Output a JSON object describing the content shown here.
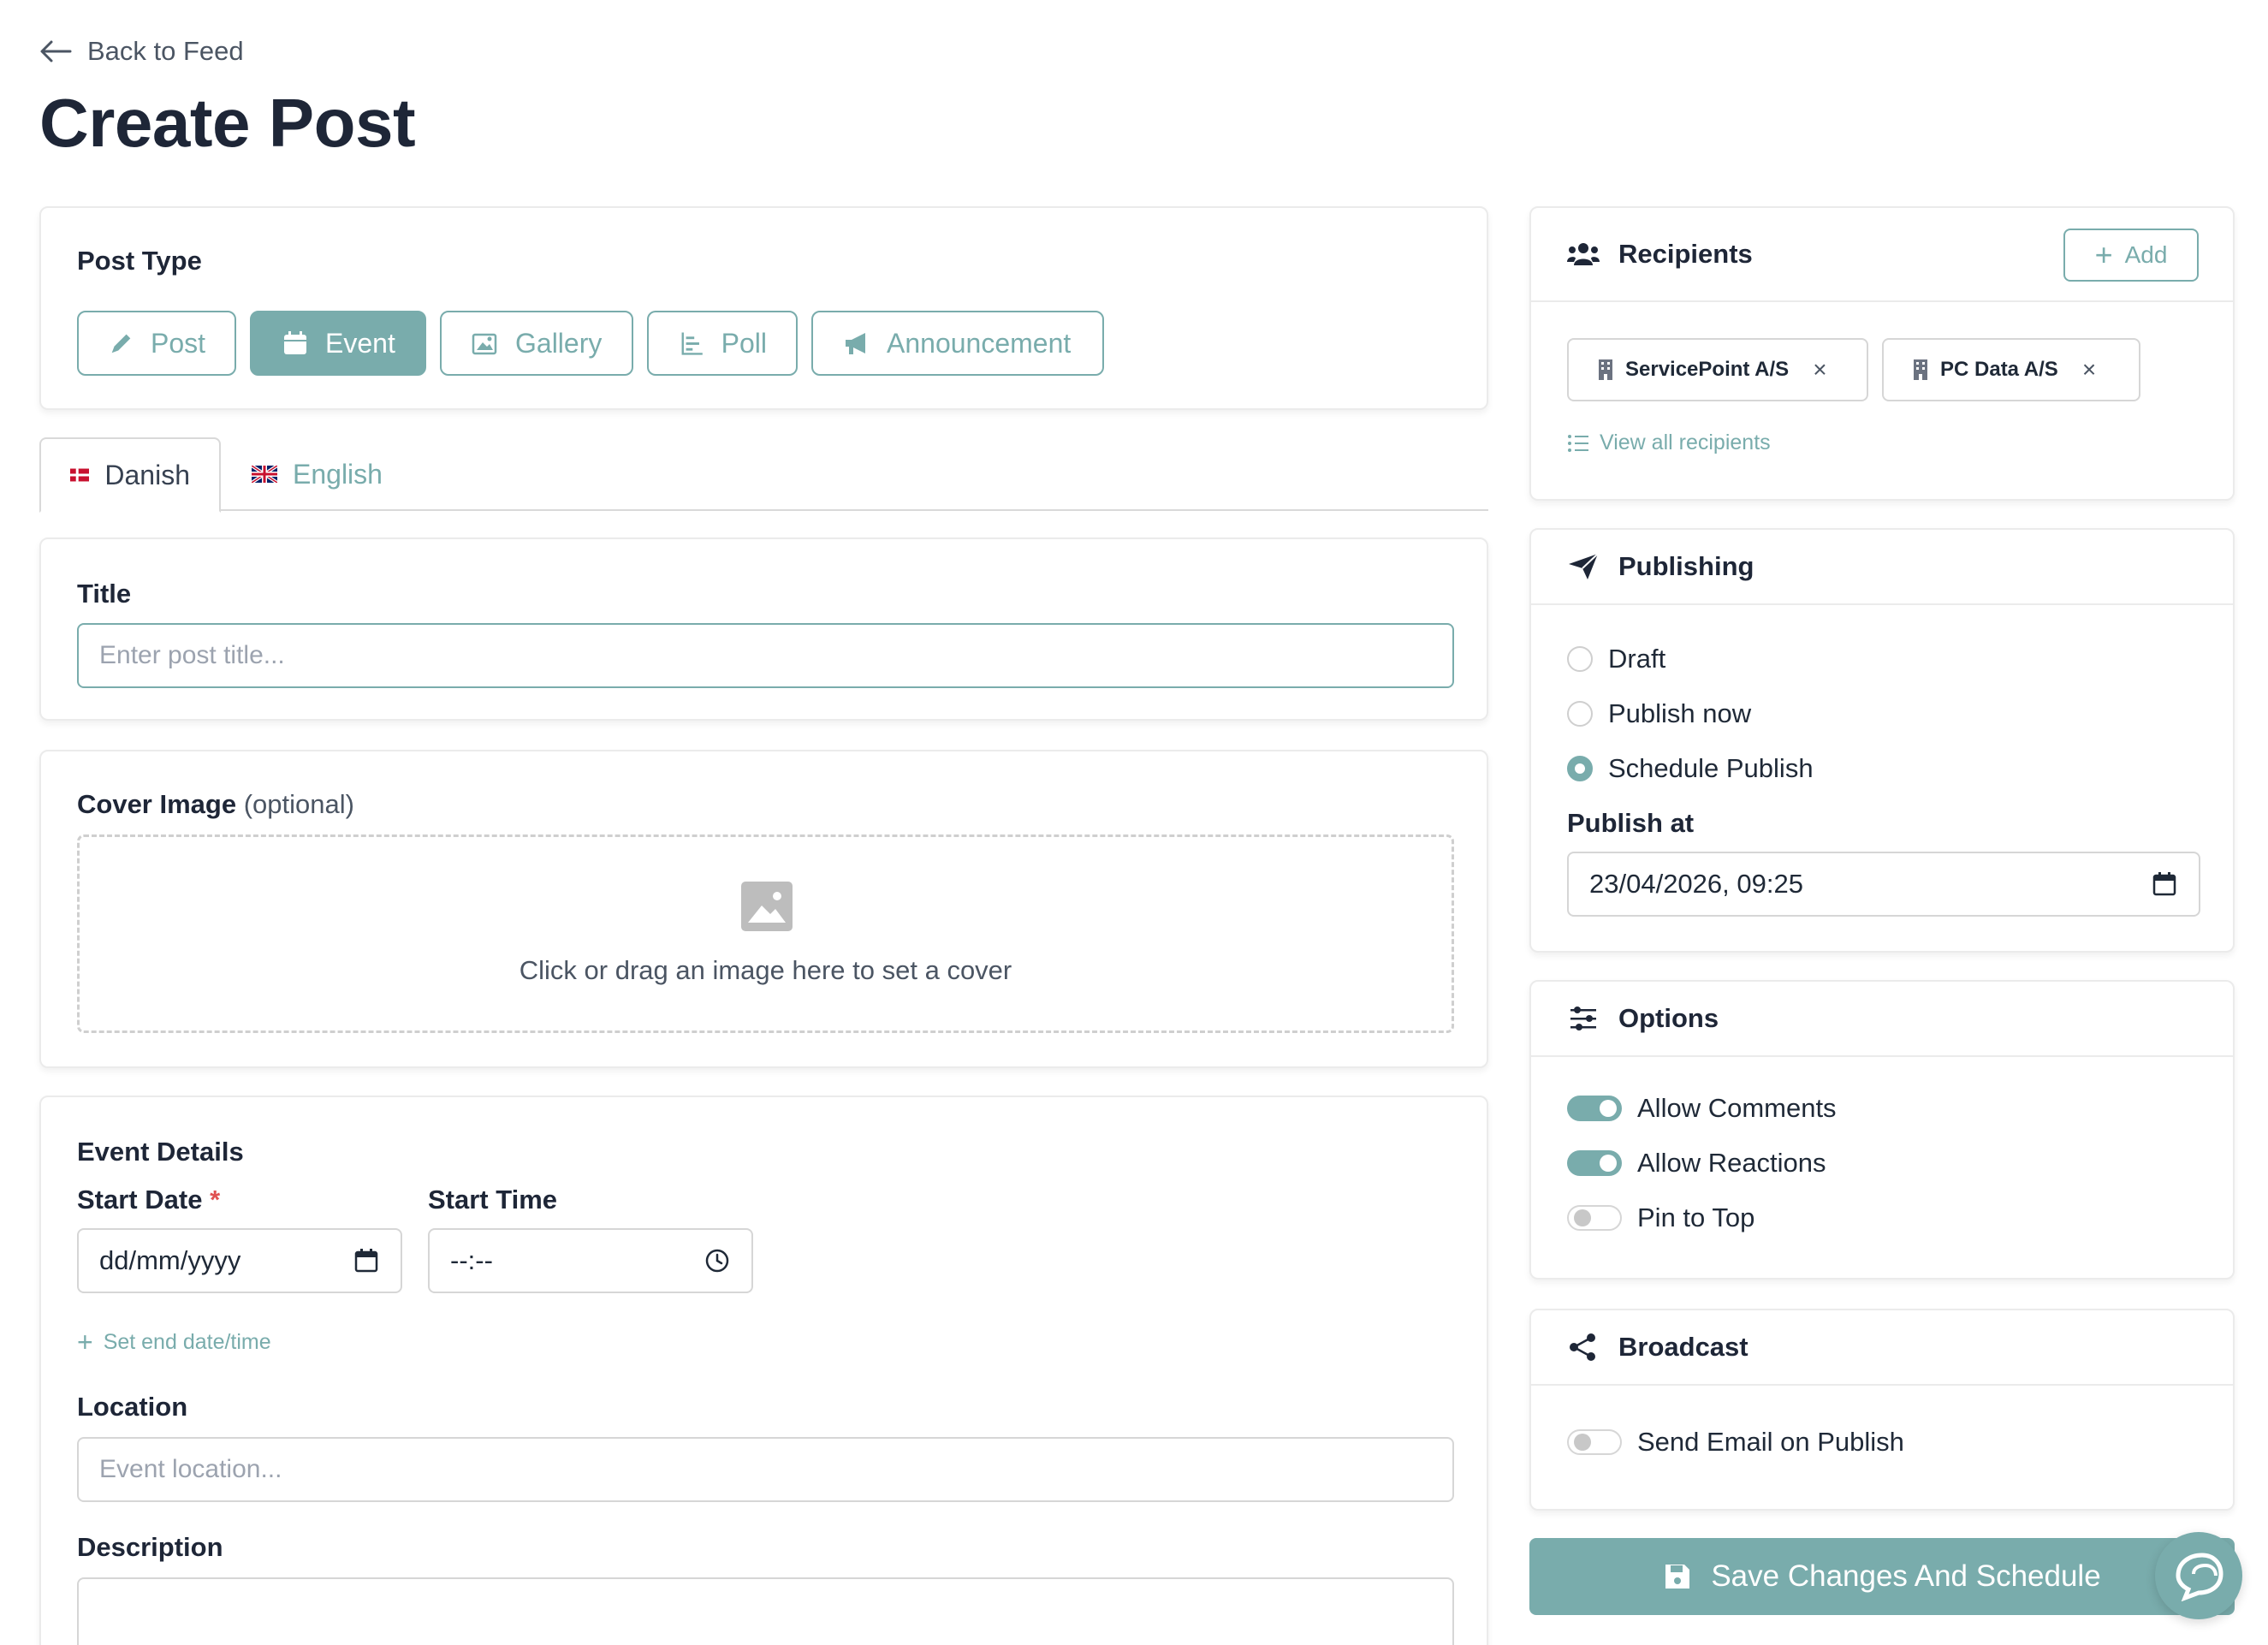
{
  "header": {
    "back_label": "Back to Feed",
    "page_title": "Create Post"
  },
  "post_type": {
    "label": "Post Type",
    "options": [
      {
        "label": "Post",
        "icon": "pencil-icon",
        "active": false
      },
      {
        "label": "Event",
        "icon": "calendar-icon",
        "active": true
      },
      {
        "label": "Gallery",
        "icon": "gallery-icon",
        "active": false
      },
      {
        "label": "Poll",
        "icon": "poll-icon",
        "active": false
      },
      {
        "label": "Announcement",
        "icon": "megaphone-icon",
        "active": false
      }
    ]
  },
  "languages": {
    "tabs": [
      {
        "label": "Danish",
        "active": true
      },
      {
        "label": "English",
        "active": false
      }
    ]
  },
  "title_field": {
    "label": "Title",
    "placeholder": "Enter post title...",
    "value": ""
  },
  "cover": {
    "label": "Cover Image",
    "optional": "(optional)",
    "hint": "Click or drag an image here to set a cover"
  },
  "event": {
    "heading": "Event Details",
    "start_date_label": "Start Date",
    "required_marker": "*",
    "start_date_placeholder": "dd/mm/yyyy",
    "start_time_label": "Start Time",
    "start_time_placeholder": "--:--",
    "end_link": "Set end date/time",
    "location_label": "Location",
    "location_placeholder": "Event location...",
    "description_label": "Description"
  },
  "recipients": {
    "heading": "Recipients",
    "add_label": "Add",
    "chips": [
      "ServicePoint A/S",
      "PC Data A/S"
    ],
    "remove_glyph": "×",
    "view_all": "View all recipients"
  },
  "publishing": {
    "heading": "Publishing",
    "options": [
      {
        "label": "Draft",
        "selected": false
      },
      {
        "label": "Publish now",
        "selected": false
      },
      {
        "label": "Schedule Publish",
        "selected": true
      }
    ],
    "publish_at_label": "Publish at",
    "publish_at_value": "23/04/2026, 09:25"
  },
  "options": {
    "heading": "Options",
    "toggles": [
      {
        "label": "Allow Comments",
        "on": true
      },
      {
        "label": "Allow Reactions",
        "on": true
      },
      {
        "label": "Pin to Top",
        "on": false
      }
    ]
  },
  "broadcast": {
    "heading": "Broadcast",
    "toggles": [
      {
        "label": "Send Email on Publish",
        "on": false
      }
    ]
  },
  "actions": {
    "save_label": "Save Changes And Schedule"
  },
  "colors": {
    "accent": "#79acac",
    "heading": "#1e2637"
  }
}
